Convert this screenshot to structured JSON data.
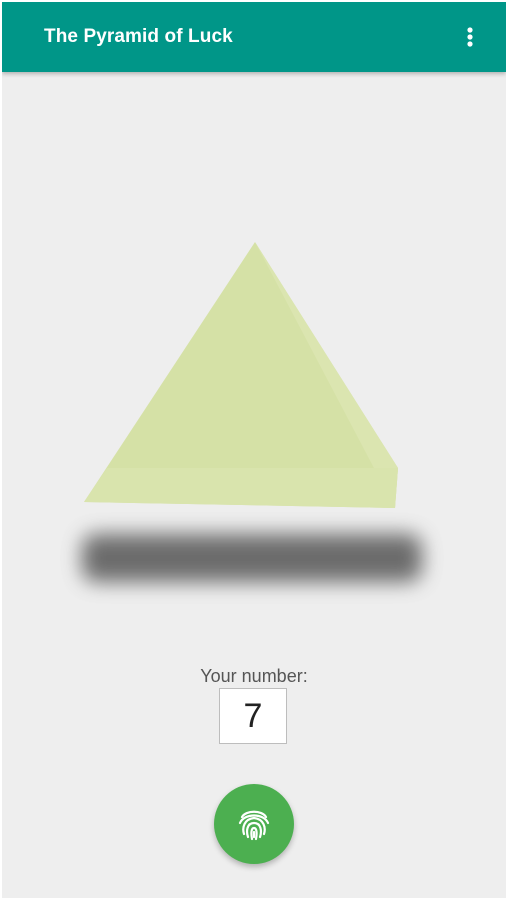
{
  "app_bar": {
    "title": "The Pyramid of Luck",
    "menu_icon": "more-vert-icon",
    "background_color": "#009688"
  },
  "scene": {
    "pyramid_icon": "pyramid-shape",
    "pyramid_color": "#d5e1a6",
    "shadow_color": "#555555"
  },
  "number_entry": {
    "label": "Your number:",
    "value": "7"
  },
  "fab": {
    "icon": "fingerprint-icon",
    "color": "#4caf50"
  }
}
